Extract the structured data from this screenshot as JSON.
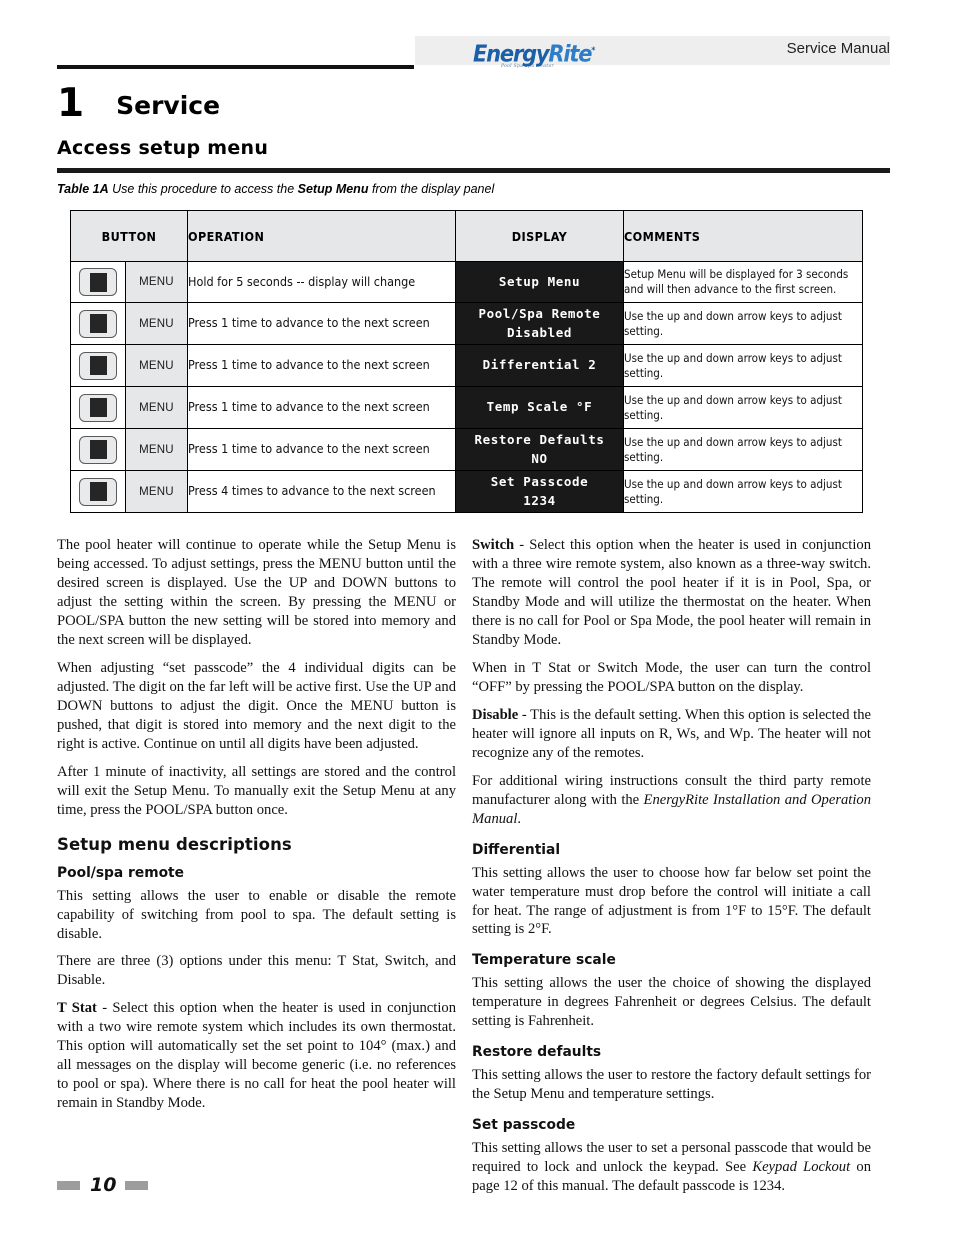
{
  "header": {
    "logo_name": "Energy",
    "logo_name_2": "Rite",
    "logo_star": "*",
    "logo_tagline": "Pool Spa  Spa Heater",
    "manual_title": "Service Manual"
  },
  "chapter": {
    "number": "1",
    "title": "Service"
  },
  "section": {
    "heading": "Access setup menu"
  },
  "table_caption": {
    "label": "Table 1A",
    "text_before": " Use this procedure to access the ",
    "bold_part": "Setup Menu",
    "text_after": " from the display panel"
  },
  "table": {
    "headers": {
      "button": "BUTTON",
      "operation": "OPERATION",
      "display": "DISPLAY",
      "comments": "COMMENTS"
    },
    "rows": [
      {
        "button_label": "MENU",
        "operation": "Hold for 5 seconds -- display will change",
        "display_line1": "Setup Menu",
        "display_line2": "",
        "comments": "Setup Menu will be displayed for 3 seconds and will then advance to the first screen."
      },
      {
        "button_label": "MENU",
        "operation": "Press 1 time to advance to the next screen",
        "display_line1": "Pool/Spa Remote",
        "display_line2": "Disabled",
        "comments": "Use the up and down arrow keys to adjust setting."
      },
      {
        "button_label": "MENU",
        "operation": "Press 1 time to advance to the next screen",
        "display_line1": "Differential 2",
        "display_line2": "",
        "comments": "Use the up and down arrow keys to adjust setting."
      },
      {
        "button_label": "MENU",
        "operation": "Press 1 time to advance to the next screen",
        "display_line1": "Temp Scale °F",
        "display_line2": "",
        "comments": "Use the up and down arrow keys to adjust setting."
      },
      {
        "button_label": "MENU",
        "operation": "Press 1 time to advance to the next screen",
        "display_line1": "Restore Defaults",
        "display_line2": "NO",
        "comments": "Use the up and down arrow keys to adjust setting."
      },
      {
        "button_label": "MENU",
        "operation": "Press 4 times to advance to the next screen",
        "display_line1": "Set Passcode",
        "display_line2": "1234",
        "comments": "Use the up and down arrow keys to adjust setting."
      }
    ]
  },
  "left_column": {
    "para_1": "The pool heater will continue to operate while the Setup Menu is being accessed.  To adjust settings, press the MENU button until the desired screen is displayed.  Use the UP and DOWN buttons to adjust the setting within the screen.  By pressing the MENU  or POOL/SPA button the new setting will be stored into memory and the next screen will be displayed.",
    "para_2": "When adjusting “set passcode” the 4 individual digits can be adjusted.  The digit on the far left will be active first.  Use the UP and DOWN buttons to adjust the digit.   Once the MENU button is pushed, that digit is stored into memory and the next digit to the right is active.  Continue on until all digits have been adjusted.",
    "para_3": "After 1 minute of inactivity, all settings are stored and the control will exit the Setup Menu.  To manually exit the Setup Menu at any time, press the POOL/SPA button once.",
    "heading_descriptions": "Setup menu descriptions",
    "heading_pool_spa": "Pool/spa remote",
    "para_4": "This setting allows the user to enable or disable the remote capability of switching from pool to spa.  The default setting is disable.",
    "para_5": "There are three (3) options under this menu:  T Stat, Switch, and Disable.",
    "tstat_bold": "T Stat",
    "tstat_text": " - Select this option when the heater is used in conjunction with a two wire remote system which includes its own thermostat.  This option will automatically set the set point to 104° (max.) and all messages on the display will become generic (i.e. no references to pool or spa).  Where there is no call for heat the pool heater will remain in Standby Mode."
  },
  "right_column": {
    "switch_bold": "Switch",
    "switch_text": " - Select this option when the heater is used in conjunction with a three wire remote system, also known as a three-way switch.  The remote will control the pool heater if it is in Pool, Spa, or Standby Mode and will utilize the thermostat on the heater.  When there is no call for Pool or Spa Mode, the pool heater will remain in Standby Mode.",
    "para_1": "When in T Stat or Switch Mode, the user can turn the control “OFF” by pressing the POOL/SPA button on the display.",
    "disable_bold": "Disable",
    "disable_text": " - This is the default setting.  When this option is selected the heater will ignore all inputs on R, Ws, and Wp.  The heater will not recognize any of the remotes.",
    "para_2_before": "For additional wiring instructions consult the third party remote manufacturer along with the ",
    "para_2_italic": "EnergyRite Installation and Operation Manual",
    "para_2_after": ".",
    "heading_differential": "Differential",
    "para_differential": "This setting allows the user to choose how far below set point the water temperature must drop before the control will initiate a call for heat.  The range of adjustment is from 1°F to 15°F.  The default setting is 2°F.",
    "heading_temp_scale": "Temperature scale",
    "para_temp_scale": "This setting allows the user the choice of showing the displayed temperature in degrees Fahrenheit or degrees Celsius.  The default setting is Fahrenheit.",
    "heading_restore": "Restore defaults",
    "para_restore": "This setting allows the user to restore the factory default settings for the Setup Menu and temperature settings.",
    "heading_passcode": "Set passcode",
    "para_passcode_before": "This setting allows the user to set a personal passcode that would be required to lock and unlock the keypad.  See ",
    "para_passcode_italic": "Keypad Lockout",
    "para_passcode_after": " on page 12 of this manual.  The default passcode is 1234."
  },
  "footer": {
    "page_number": "10"
  }
}
